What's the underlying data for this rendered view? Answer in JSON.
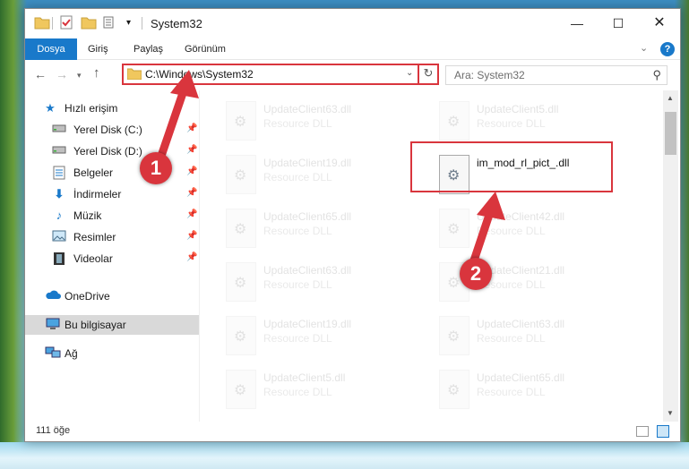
{
  "window": {
    "title": "System32"
  },
  "ribbon": {
    "tabs": [
      {
        "label": "Dosya",
        "active": true
      },
      {
        "label": "Giriş",
        "active": false
      },
      {
        "label": "Paylaş",
        "active": false
      },
      {
        "label": "Görünüm",
        "active": false
      }
    ]
  },
  "navigation": {
    "address": "C:\\Windows\\System32",
    "search_placeholder": "Ara: System32"
  },
  "sidebar": {
    "items": [
      {
        "label": "Hızlı erişim",
        "icon": "star-icon",
        "pinned": false
      },
      {
        "label": "Yerel Disk (C:)",
        "icon": "drive-icon",
        "pinned": true
      },
      {
        "label": "Yerel Disk (D:)",
        "icon": "drive-icon",
        "pinned": true
      },
      {
        "label": "Belgeler",
        "icon": "documents-icon",
        "pinned": true
      },
      {
        "label": "İndirmeler",
        "icon": "download-icon",
        "pinned": true
      },
      {
        "label": "Müzik",
        "icon": "music-icon",
        "pinned": true
      },
      {
        "label": "Resimler",
        "icon": "pictures-icon",
        "pinned": true
      },
      {
        "label": "Videolar",
        "icon": "video-icon",
        "pinned": true
      },
      {
        "label": "OneDrive",
        "icon": "cloud-icon",
        "pinned": false
      },
      {
        "label": "Bu bilgisayar",
        "icon": "computer-icon",
        "pinned": false,
        "selected": true
      },
      {
        "label": "Ağ",
        "icon": "network-icon",
        "pinned": false
      }
    ]
  },
  "files": [
    {
      "name": "UpdateClient63.dll",
      "type": "Resource DLL"
    },
    {
      "name": "UpdateClient5.dll",
      "type": "Resource DLL"
    },
    {
      "name": "UpdateClient19.dll",
      "type": "Resource DLL"
    },
    {
      "name": "im_mod_rl_pict_.dll",
      "type": "",
      "highlighted": true
    },
    {
      "name": "UpdateClient65.dll",
      "type": "Resource DLL"
    },
    {
      "name": "UpdateClient42.dll",
      "type": "Resource DLL"
    },
    {
      "name": "UpdateClient63.dll",
      "type": "Resource DLL"
    },
    {
      "name": "UpdateClient21.dll",
      "type": "Resource DLL"
    },
    {
      "name": "UpdateClient19.dll",
      "type": "Resource DLL"
    },
    {
      "name": "UpdateClient63.dll",
      "type": "Resource DLL"
    },
    {
      "name": "UpdateClient5.dll",
      "type": "Resource DLL"
    },
    {
      "name": "UpdateClient65.dll",
      "type": "Resource DLL"
    }
  ],
  "status": {
    "item_count": "111 öğe"
  },
  "callouts": {
    "step1": "1",
    "step2": "2"
  },
  "colors": {
    "accent": "#1979ca",
    "highlight_red": "#d9353d"
  }
}
